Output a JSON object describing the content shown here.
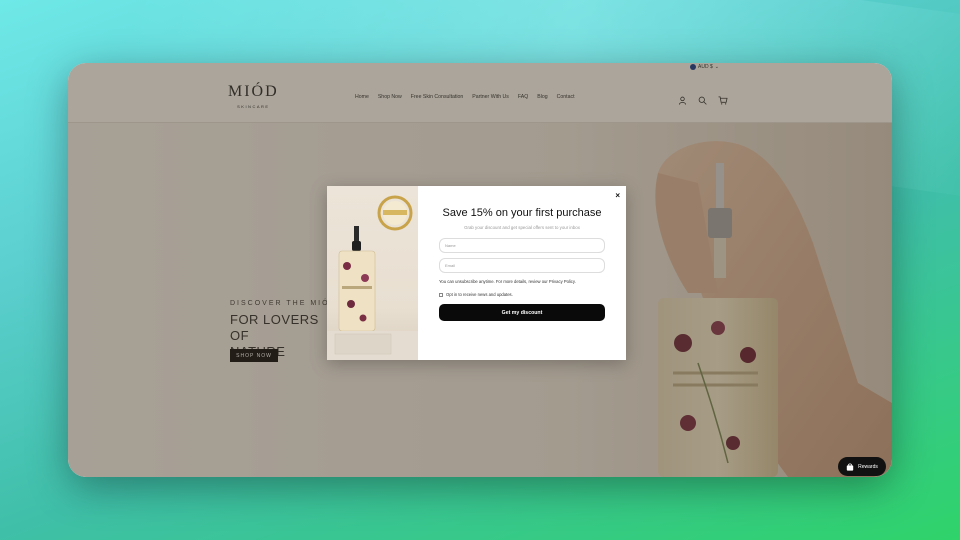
{
  "header": {
    "currency": "AUD $",
    "logo_main": "MIÓD",
    "logo_sub": "SKINCARE",
    "nav": [
      "Home",
      "Shop Now",
      "Free Skin Consultation",
      "Partner With Us",
      "FAQ",
      "Blog",
      "Contact"
    ],
    "icons": [
      "account-icon",
      "search-icon",
      "cart-icon"
    ]
  },
  "hero": {
    "kicker": "DISCOVER THE MIÓD",
    "title_line1": "FOR LOVERS OF",
    "title_line2": "NATURE",
    "button": "SHOP NOW"
  },
  "popup": {
    "close": "×",
    "title": "Save 15% on your first purchase",
    "subtitle": "Grab your discount and get special offers sent to your inbox",
    "name_placeholder": "Name",
    "email_placeholder": "Email",
    "note": "You can unsubscribe anytime. For more details, review our Privacy Policy.",
    "checkbox_label": "Opt in to receive news and updates.",
    "button": "Get my discount"
  },
  "rewards": {
    "label": "Rewards"
  },
  "colors": {
    "overlay": "#3c3020",
    "button": "#0a0a0a",
    "accent_green": "#2fd36a"
  }
}
